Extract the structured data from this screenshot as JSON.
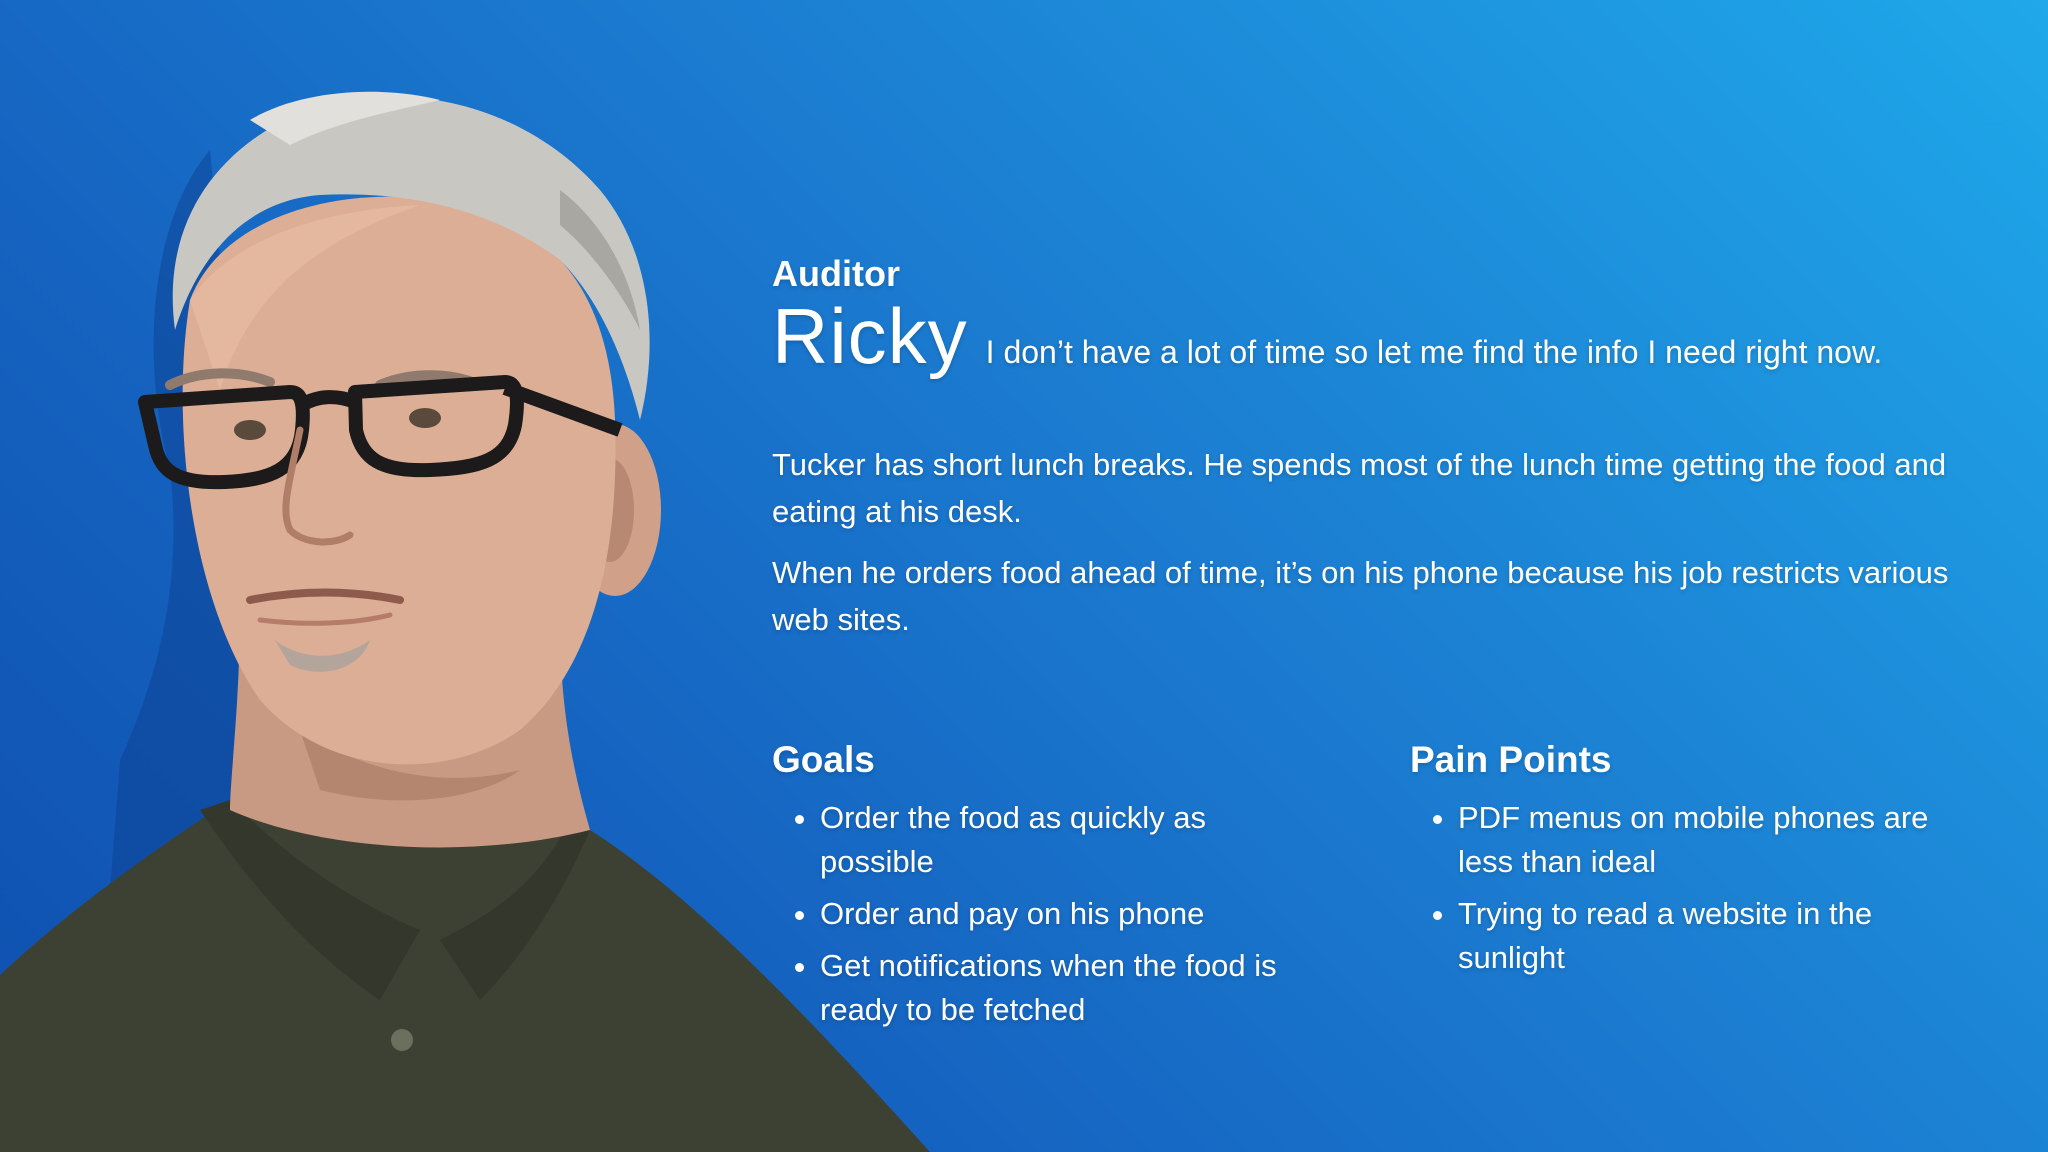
{
  "persona": {
    "role": "Auditor",
    "name": "Ricky",
    "quote": "I don’t have a lot of time so let me find the info I need right now.",
    "description": [
      "Tucker has short lunch breaks. He spends most of the lunch time getting the food and eating at his desk.",
      "When he orders food ahead of time, it’s on his phone because his job restricts various web sites."
    ],
    "goals": {
      "heading": "Goals",
      "items": [
        "Order the food as quickly as possible",
        "Order and pay on his phone",
        "Get notifications when the food is ready to be fetched"
      ]
    },
    "pain_points": {
      "heading": "Pain Points",
      "items": [
        "PDF menus on mobile phones are less than ideal",
        "Trying to read a website in the sunlight"
      ]
    }
  },
  "colors": {
    "background_start": "#1fa8ea",
    "background_end": "#0f4fae",
    "text": "#ffffff",
    "shirt": "#3d4134"
  }
}
